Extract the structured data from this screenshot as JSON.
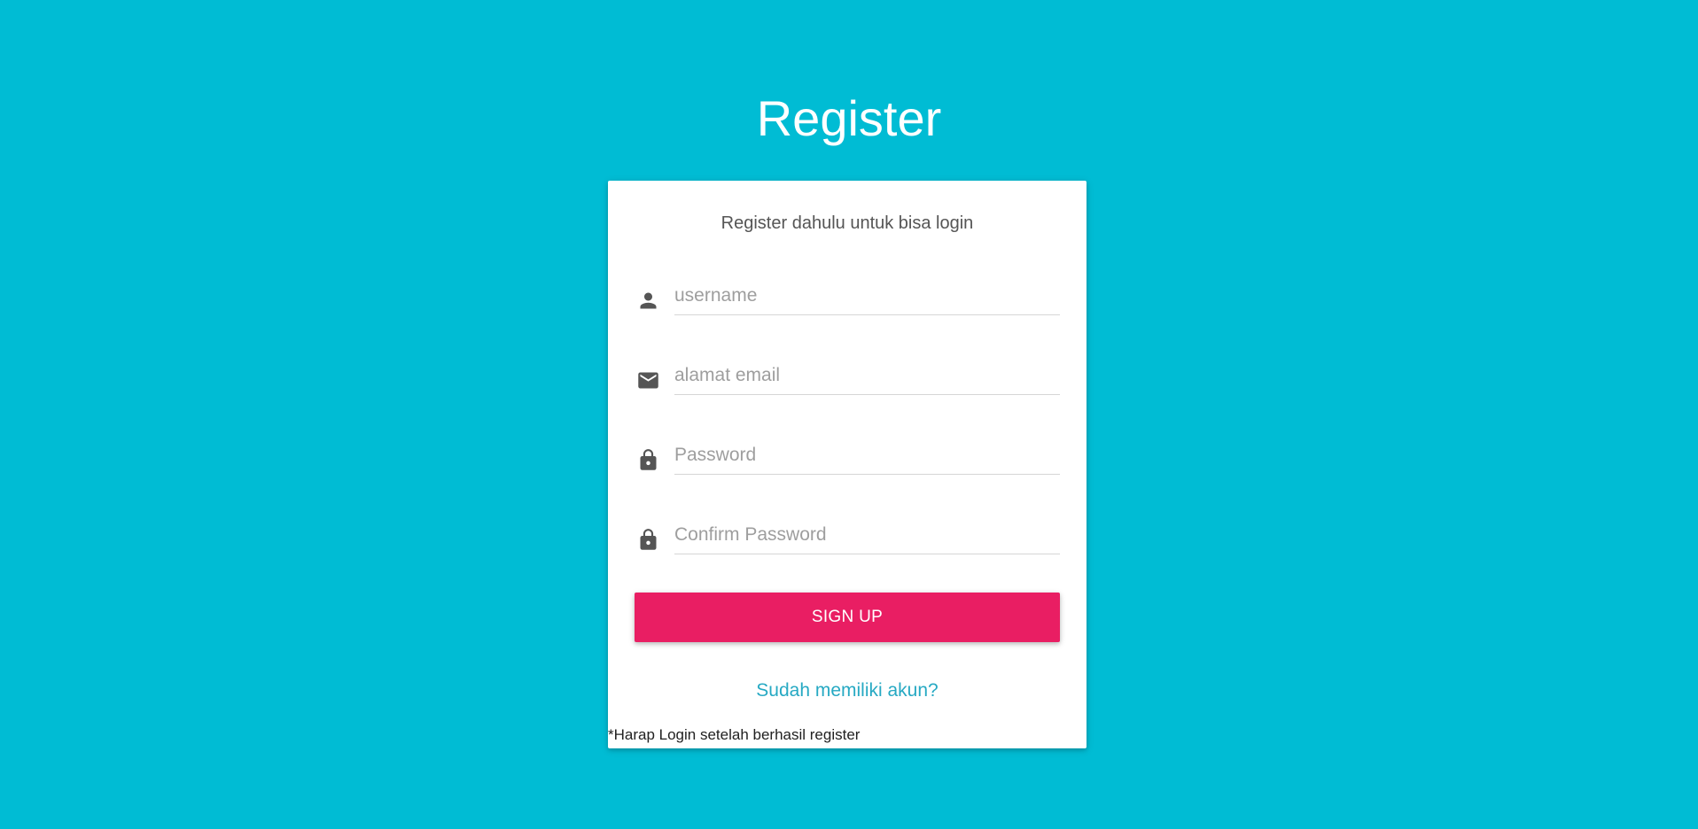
{
  "page": {
    "title": "Register",
    "background_color": "#00bcd4"
  },
  "card": {
    "subtitle": "Register dahulu untuk bisa login",
    "fields": [
      {
        "name": "username",
        "icon": "person-icon",
        "placeholder": "username",
        "value": ""
      },
      {
        "name": "email",
        "icon": "email-icon",
        "placeholder": "alamat email",
        "value": ""
      },
      {
        "name": "password",
        "icon": "lock-icon",
        "placeholder": "Password",
        "value": ""
      },
      {
        "name": "confirm_password",
        "icon": "lock-icon",
        "placeholder": "Confirm Password",
        "value": ""
      }
    ],
    "signup_label": "SIGN UP",
    "signup_color": "#e91e63",
    "login_link_text": "Sudah memiliki akun?",
    "link_color": "#26a9c3",
    "footnote": "*Harap Login setelah berhasil register"
  }
}
